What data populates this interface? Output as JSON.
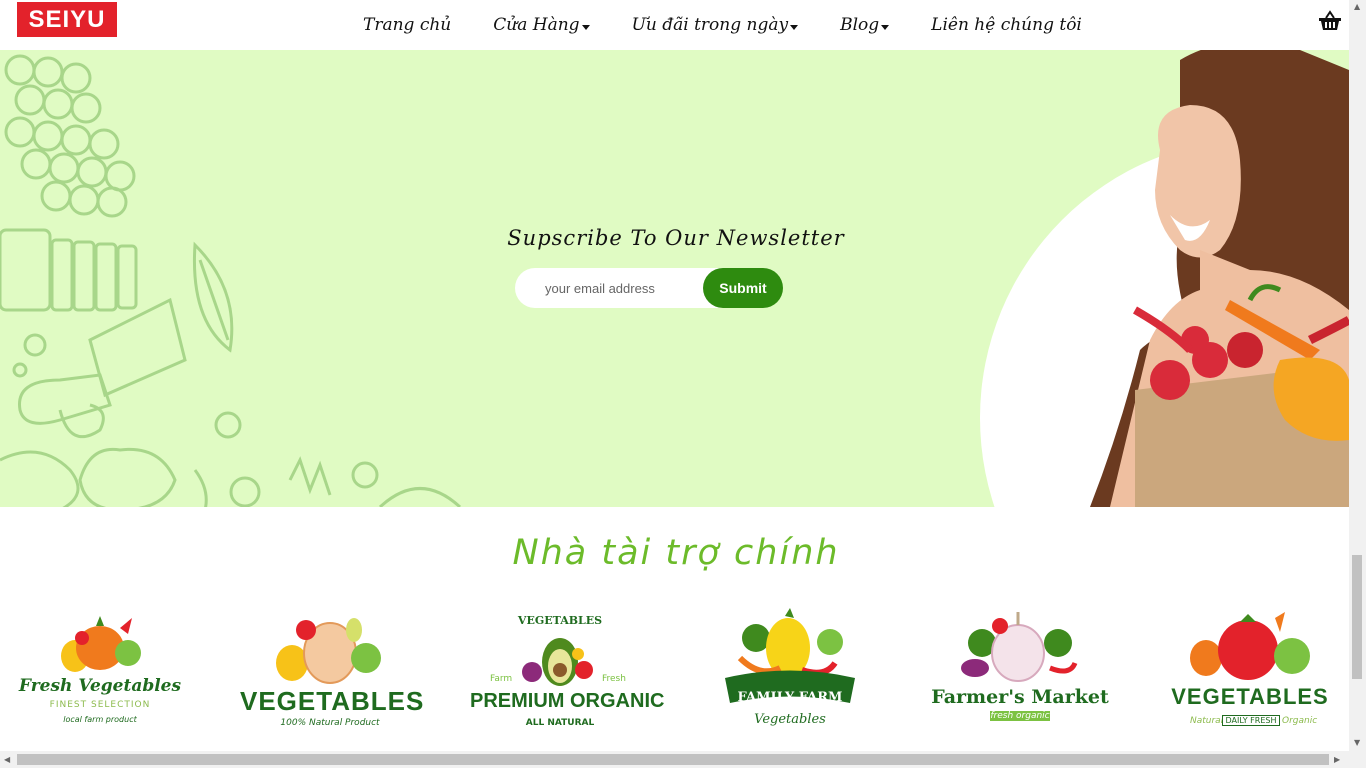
{
  "header": {
    "logo": "SEIYU",
    "nav": [
      {
        "label": "Trang chủ",
        "dropdown": false
      },
      {
        "label": "Cửa Hàng",
        "dropdown": true
      },
      {
        "label": "Ưu đãi trong ngày",
        "dropdown": true
      },
      {
        "label": "Blog",
        "dropdown": true
      },
      {
        "label": "Liên hệ chúng tôi",
        "dropdown": false
      }
    ],
    "cart_icon": "basket-icon"
  },
  "newsletter": {
    "title": "Supscribe To Our Newsletter",
    "email_placeholder": "your email address",
    "submit_label": "Submit",
    "background": "#e0fbc3",
    "button_color": "#2e8b0f"
  },
  "sponsors": {
    "title": "Nhà tài trợ chính",
    "title_color": "#6cbb2a",
    "items": [
      {
        "name": "Fresh Vegetables",
        "sub": "FINEST SELECTION",
        "tagline": "local farm product"
      },
      {
        "name": "VEGETABLES",
        "sub": "100% Natural Product"
      },
      {
        "name": "PREMIUM ORGANIC",
        "top": "VEGETABLES",
        "left": "Farm",
        "right": "Fresh",
        "sub": "ALL NATURAL"
      },
      {
        "name": "FAMILY FARM",
        "sub": "Vegetables"
      },
      {
        "name": "Farmer's Market",
        "sub": "fresh organic"
      },
      {
        "name": "VEGETABLES",
        "sub": "DAILY FRESH",
        "left": "Natural",
        "right": "Organic"
      }
    ]
  }
}
